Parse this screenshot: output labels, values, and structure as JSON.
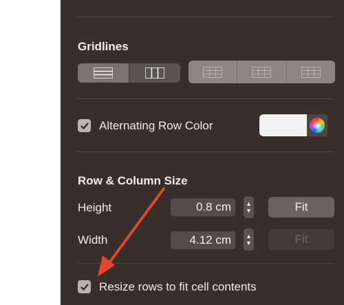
{
  "gridlines": {
    "title": "Gridlines",
    "group_a": [
      "horizontal-lines-icon",
      "vertical-lines-icon"
    ],
    "group_b": [
      "header-row-lines-icon",
      "header-column-lines-icon",
      "footer-row-lines-icon"
    ]
  },
  "alternating": {
    "label": "Alternating Row Color",
    "checked": true,
    "swatch_color": "#f2f2f2"
  },
  "row_column_size": {
    "title": "Row & Column Size",
    "height_label": "Height",
    "height_value": "0.8 cm",
    "width_label": "Width",
    "width_value": "4.12 cm",
    "fit_label": "Fit"
  },
  "resize": {
    "label": "Resize rows to fit cell contents",
    "checked": true
  },
  "colors": {
    "panel_bg": "#382f2a",
    "annotation_arrow": "#e3452f"
  }
}
